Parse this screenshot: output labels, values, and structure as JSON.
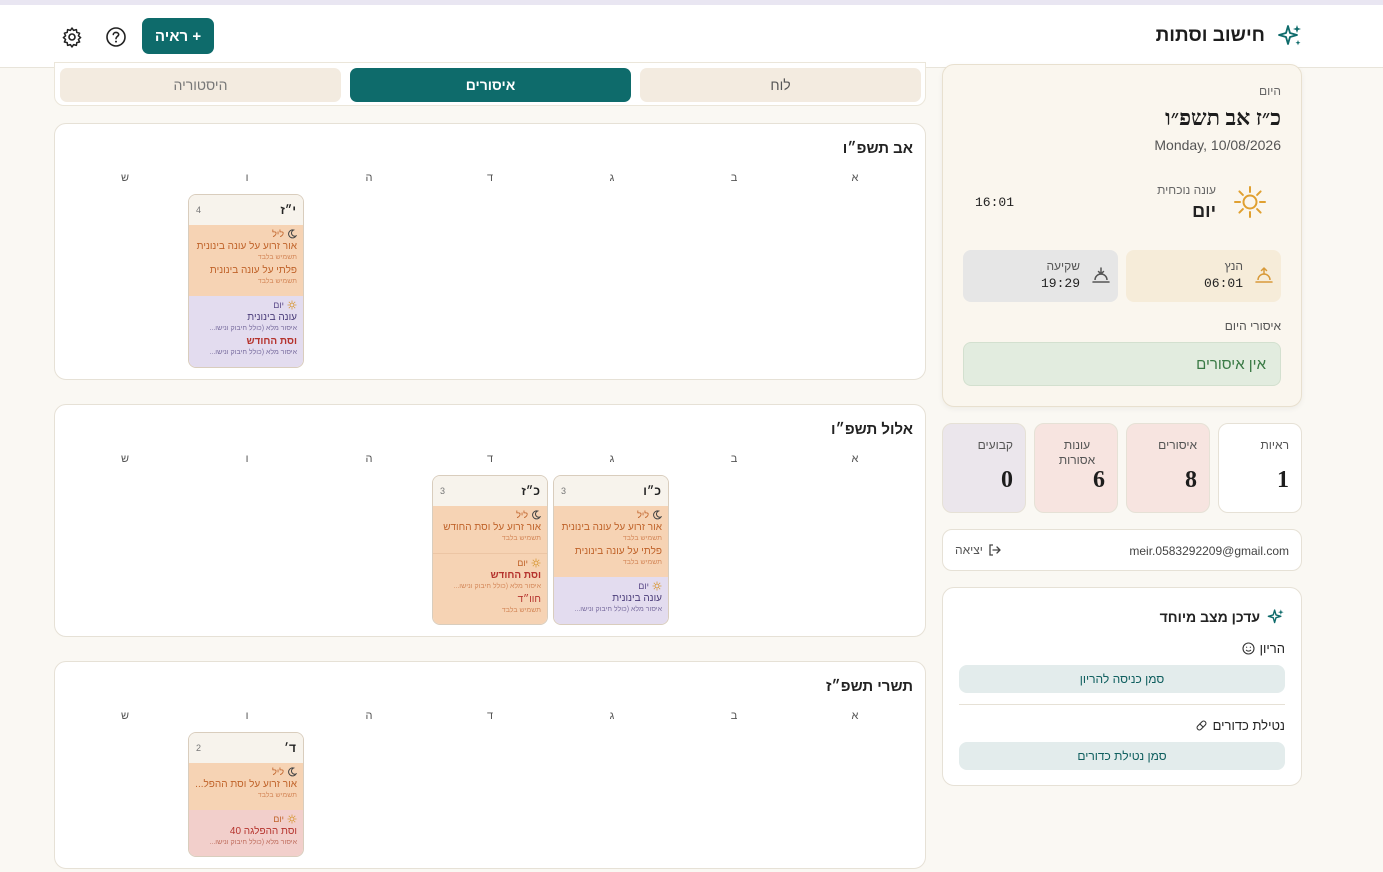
{
  "header": {
    "app_title": "חישוב וסתות",
    "new_button_label": "+ ראיה"
  },
  "tabs": [
    {
      "label": "לוח"
    },
    {
      "label": "איסורים"
    },
    {
      "label": "היסטוריה"
    }
  ],
  "weekdays": [
    "א",
    "ב",
    "ג",
    "ד",
    "ה",
    "ו",
    "ש"
  ],
  "months": [
    {
      "title": "אב תשפ״ו",
      "cells": [
        {
          "day": "י״ז",
          "count": "4",
          "night_label": "ליל",
          "night_items": [
            {
              "title": "אור זרוע על עונה בינונית",
              "sub": "תשמיש בלבד"
            },
            {
              "title": "פלתי על עונה בינונית",
              "sub": "תשמיש בלבד"
            }
          ],
          "day_label": "יום",
          "day_items": [
            {
              "title": "עונה בינונית",
              "sub": "איסור מלא (כולל חיבוק ונישו..."
            },
            {
              "title": "וסת החודש",
              "sub": "איסור מלא (כולל חיבוק ונישו..."
            }
          ]
        }
      ]
    },
    {
      "title": "אלול תשפ״ו",
      "cells": [
        {
          "day": "כ״ו",
          "count": "3",
          "night_label": "ליל",
          "night_items": [
            {
              "title": "אור זרוע על עונה בינונית",
              "sub": "תשמיש בלבד"
            },
            {
              "title": "פלתי על עונה בינונית",
              "sub": "תשמיש בלבד"
            }
          ],
          "day_label": "יום",
          "day_items": [
            {
              "title": "עונה בינונית",
              "sub": "איסור מלא (כולל חיבוק ונישו..."
            }
          ]
        },
        {
          "day": "כ״ז",
          "count": "3",
          "night_label": "ליל",
          "night_items": [
            {
              "title": "אור זרוע על וסת החודש",
              "sub": "תשמיש בלבד"
            }
          ],
          "day_label": "יום",
          "day_items": [
            {
              "title": "וסת החודש",
              "sub": "איסור מלא (כולל חיבוק ונישו..."
            },
            {
              "title": "חוו״ד",
              "sub": "תשמיש בלבד"
            }
          ]
        }
      ]
    },
    {
      "title": "תשרי תשפ״ז",
      "cells": [
        {
          "day": "ד׳",
          "count": "2",
          "night_label": "ליל",
          "night_items": [
            {
              "title": "אור זרוע על וסת ההפל...",
              "sub": "תשמיש בלבד"
            }
          ],
          "day_label": "יום",
          "day_items": [
            {
              "title": "וסת ההפלגה 40",
              "sub": "איסור מלא (כולל חיבוק ונישו..."
            }
          ]
        }
      ]
    }
  ],
  "today": {
    "label": "היום",
    "hebrew_date": "כ״ז אב תשפ״ו",
    "gregorian_date": "Monday, 10/08/2026",
    "onah_label": "עונה נוכחית",
    "onah_value": "יום",
    "onah_time": "16:01",
    "sunrise_label": "הנץ",
    "sunrise_time": "06:01",
    "sunset_label": "שקיעה",
    "sunset_time": "19:29",
    "issurim_label": "איסורי היום",
    "no_issurim": "אין איסורים"
  },
  "stats": [
    {
      "label": "ראיות",
      "value": "1"
    },
    {
      "label": "איסורים",
      "value": "8"
    },
    {
      "label": "עונות אסורות",
      "value": "6"
    },
    {
      "label": "קבועים",
      "value": "0"
    }
  ],
  "user": {
    "email": "meir.0583292209@gmail.com",
    "logout_label": "יציאה"
  },
  "special": {
    "title": "עדכן מצב מיוחד",
    "pregnancy_label": "הריון",
    "pregnancy_button": "סמן כניסה להריון",
    "pills_label": "נטילת כדורים",
    "pills_button": "סמן נטילת כדורים"
  },
  "colors": {
    "accent": "#0e6b6b",
    "night_bg": "#f6d3b4",
    "day_bg": "#e3dcef",
    "danger": "#b5332d"
  }
}
